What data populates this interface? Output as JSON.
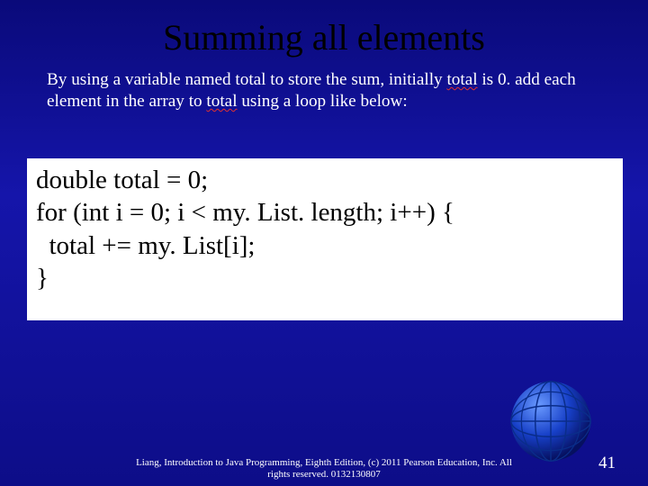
{
  "title": "Summing all elements",
  "body": {
    "pre1": "By using a variable named total to store the sum, initially ",
    "err1": "total",
    "mid1": " is 0.  add each element in the array to ",
    "err2": "total",
    "post1": " using a loop like below:"
  },
  "code": "double total = 0;\nfor (int i = 0; i < my. List. length; i++) {\n  total += my. List[i];\n}",
  "footer_line1": "Liang, Introduction to Java Programming, Eighth Edition, (c) 2011 Pearson Education, Inc. All",
  "footer_line2": "rights reserved. 0132130807",
  "page_number": "41"
}
